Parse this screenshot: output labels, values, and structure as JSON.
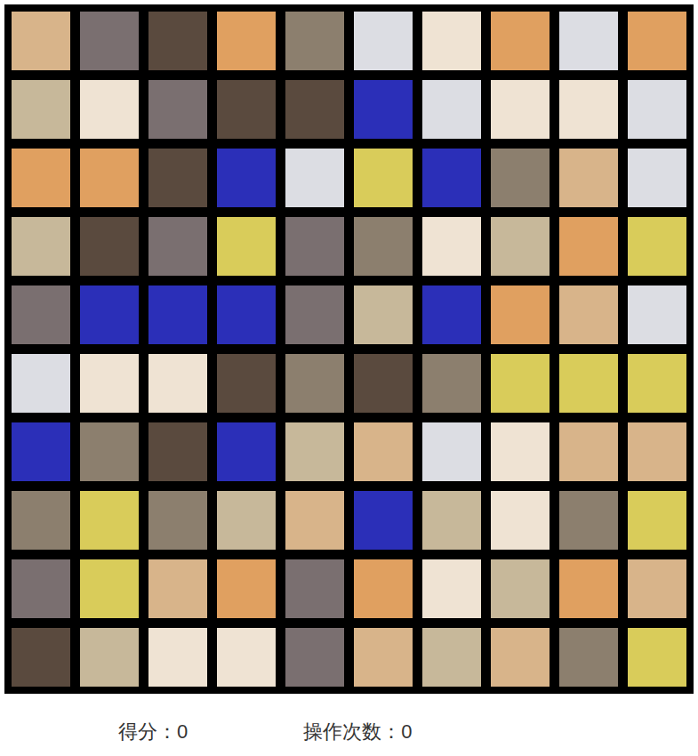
{
  "board": {
    "rows": [
      [
        {
          "color": "#d8b48a"
        },
        {
          "color": "#7a6f70"
        },
        {
          "color": "#5a4a3e"
        },
        {
          "color": "#e0a060"
        },
        {
          "color": "#8c7f6e"
        },
        {
          "color": "#dcdde3"
        },
        {
          "color": "#efe3d3"
        },
        {
          "color": "#e0a060"
        },
        {
          "color": "#dcdde3"
        },
        {
          "color": "#e0a060"
        }
      ],
      [
        {
          "color": "#c7b89a"
        },
        {
          "color": "#efe3d3"
        },
        {
          "color": "#7a6f70"
        },
        {
          "color": "#5a4a3e"
        },
        {
          "color": "#5a4a3e"
        },
        {
          "color": "#2b2fb8"
        },
        {
          "color": "#dcdde3"
        },
        {
          "color": "#efe3d3"
        },
        {
          "color": "#efe3d3"
        },
        {
          "color": "#dcdde3"
        }
      ],
      [
        {
          "color": "#e0a060"
        },
        {
          "color": "#e0a060"
        },
        {
          "color": "#5a4a3e"
        },
        {
          "color": "#2b2fb8"
        },
        {
          "color": "#dcdde3"
        },
        {
          "color": "#d9cc5a"
        },
        {
          "color": "#2b2fb8"
        },
        {
          "color": "#8c7f6e"
        },
        {
          "color": "#d8b48a"
        },
        {
          "color": "#dcdde3"
        }
      ],
      [
        {
          "color": "#c7b89a"
        },
        {
          "color": "#5a4a3e"
        },
        {
          "color": "#7a6f70"
        },
        {
          "color": "#d9cc5a"
        },
        {
          "color": "#7a6f70"
        },
        {
          "color": "#8c7f6e"
        },
        {
          "color": "#efe3d3"
        },
        {
          "color": "#c7b89a"
        },
        {
          "color": "#e0a060"
        },
        {
          "color": "#d9cc5a"
        }
      ],
      [
        {
          "color": "#7a6f70"
        },
        {
          "color": "#2b2fb8"
        },
        {
          "color": "#2b2fb8"
        },
        {
          "color": "#2b2fb8"
        },
        {
          "color": "#7a6f70"
        },
        {
          "color": "#c7b89a"
        },
        {
          "color": "#2b2fb8"
        },
        {
          "color": "#e0a060"
        },
        {
          "color": "#d8b48a"
        },
        {
          "color": "#dcdde3"
        }
      ],
      [
        {
          "color": "#dcdde3"
        },
        {
          "color": "#efe3d3"
        },
        {
          "color": "#efe3d3"
        },
        {
          "color": "#5a4a3e"
        },
        {
          "color": "#8c7f6e"
        },
        {
          "color": "#5a4a3e"
        },
        {
          "color": "#8c7f6e"
        },
        {
          "color": "#d9cc5a"
        },
        {
          "color": "#d9cc5a"
        },
        {
          "color": "#d9cc5a"
        }
      ],
      [
        {
          "color": "#2b2fb8"
        },
        {
          "color": "#8c7f6e"
        },
        {
          "color": "#5a4a3e"
        },
        {
          "color": "#2b2fb8"
        },
        {
          "color": "#c7b89a"
        },
        {
          "color": "#d8b48a"
        },
        {
          "color": "#dcdde3"
        },
        {
          "color": "#efe3d3"
        },
        {
          "color": "#d8b48a"
        },
        {
          "color": "#d8b48a"
        }
      ],
      [
        {
          "color": "#8c7f6e"
        },
        {
          "color": "#d9cc5a"
        },
        {
          "color": "#8c7f6e"
        },
        {
          "color": "#c7b89a"
        },
        {
          "color": "#d8b48a"
        },
        {
          "color": "#2b2fb8"
        },
        {
          "color": "#c7b89a"
        },
        {
          "color": "#efe3d3"
        },
        {
          "color": "#8c7f6e"
        },
        {
          "color": "#d9cc5a"
        }
      ],
      [
        {
          "color": "#7a6f70"
        },
        {
          "color": "#d9cc5a"
        },
        {
          "color": "#d8b48a"
        },
        {
          "color": "#e0a060"
        },
        {
          "color": "#7a6f70"
        },
        {
          "color": "#e0a060"
        },
        {
          "color": "#efe3d3"
        },
        {
          "color": "#c7b89a"
        },
        {
          "color": "#e0a060"
        },
        {
          "color": "#d8b48a"
        }
      ],
      [
        {
          "color": "#5a4a3e"
        },
        {
          "color": "#c7b89a"
        },
        {
          "color": "#efe3d3"
        },
        {
          "color": "#efe3d3"
        },
        {
          "color": "#7a6f70"
        },
        {
          "color": "#d8b48a"
        },
        {
          "color": "#c7b89a"
        },
        {
          "color": "#d8b48a"
        },
        {
          "color": "#8c7f6e"
        },
        {
          "color": "#d9cc5a"
        }
      ]
    ]
  },
  "status": {
    "score": {
      "label": "得分：",
      "value": "0"
    },
    "moves": {
      "label": "操作次数：",
      "value": "0"
    }
  }
}
